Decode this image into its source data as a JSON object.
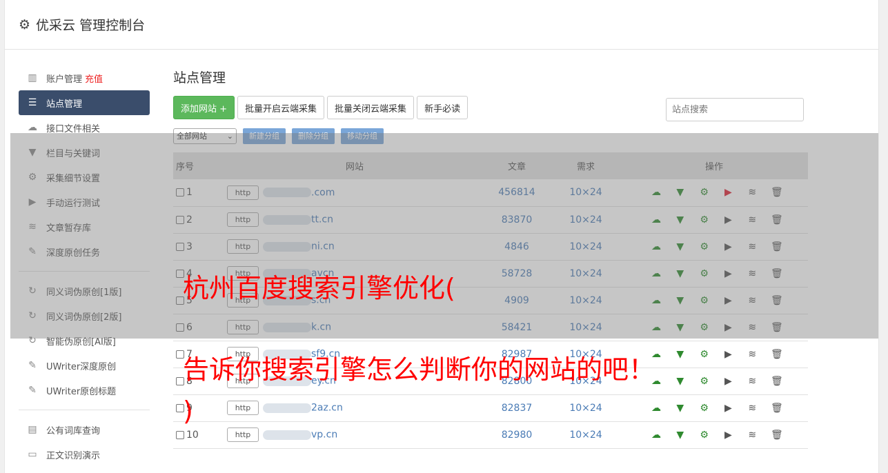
{
  "app": {
    "title": "优采云 管理控制台"
  },
  "sidebar": {
    "group1": [
      {
        "icon": "bar-chart-icon",
        "label": "账户管理",
        "badge": "充值"
      },
      {
        "icon": "server-icon",
        "label": "站点管理",
        "active": true
      },
      {
        "icon": "cloud-upload-icon",
        "label": "接口文件相关"
      },
      {
        "icon": "filter-icon",
        "label": "栏目与关键词"
      },
      {
        "icon": "gears-icon",
        "label": "采集细节设置"
      },
      {
        "icon": "play-icon",
        "label": "手动运行测试"
      },
      {
        "icon": "database-icon",
        "label": "文章暂存库"
      },
      {
        "icon": "edit-icon",
        "label": "深度原创任务"
      }
    ],
    "group2": [
      {
        "icon": "refresh-icon",
        "label": "同义词伪原创[1版]"
      },
      {
        "icon": "refresh-icon",
        "label": "同义词伪原创[2版]"
      },
      {
        "icon": "refresh-icon",
        "label": "智能伪原创[AI版]"
      },
      {
        "icon": "edit-icon",
        "label": "UWriter深度原创"
      },
      {
        "icon": "edit-icon",
        "label": "UWriter原创标题"
      }
    ],
    "group3": [
      {
        "icon": "book-icon",
        "label": "公有词库查询"
      },
      {
        "icon": "monitor-icon",
        "label": "正文识别演示"
      }
    ]
  },
  "main": {
    "title": "站点管理",
    "buttons": {
      "add": "添加网站 +",
      "batch_on": "批量开启云端采集",
      "batch_off": "批量关闭云端采集",
      "guide": "新手必读"
    },
    "search_placeholder": "站点搜索",
    "filter_select": "全部网站",
    "group_buttons": [
      "新建分组",
      "删除分组",
      "移动分组"
    ],
    "table": {
      "headers": [
        "序号",
        "网站",
        "文章",
        "需求",
        "操作"
      ],
      "rows": [
        {
          "no": "1",
          "proto": "http",
          "site": ".com",
          "articles": "456814",
          "demand": "10×24",
          "running": true
        },
        {
          "no": "2",
          "proto": "http",
          "site": "tt.cn",
          "articles": "83870",
          "demand": "10×24"
        },
        {
          "no": "3",
          "proto": "http",
          "site": "ni.cn",
          "articles": "4846",
          "demand": "10×24"
        },
        {
          "no": "4",
          "proto": "http",
          "site": "avcn",
          "articles": "58728",
          "demand": "10×24"
        },
        {
          "no": "5",
          "proto": "http",
          "site": "s.cn",
          "articles": "4909",
          "demand": "10×24"
        },
        {
          "no": "6",
          "proto": "http",
          "site": "k.cn",
          "articles": "58421",
          "demand": "10×24"
        },
        {
          "no": "7",
          "proto": "http",
          "site": "sf9.cn",
          "articles": "82987",
          "demand": "10×24"
        },
        {
          "no": "8",
          "proto": "http",
          "site": "ey.cn",
          "articles": "82800",
          "demand": "10×24"
        },
        {
          "no": "9",
          "proto": "http",
          "site": "2az.cn",
          "articles": "82837",
          "demand": "10×24"
        },
        {
          "no": "10",
          "proto": "http",
          "site": "vp.cn",
          "articles": "82980",
          "demand": "10×24"
        }
      ]
    }
  },
  "overlay": {
    "line1": "杭州百度搜索引擎优化(",
    "line2": "告诉你搜索引擎怎么判断你的网站的吧！",
    "line3": ")"
  },
  "colors": {
    "active_nav": "#3a4d6b",
    "add_button": "#5cb85c",
    "link": "#4a7bb5",
    "overlay_text": "#ff0000"
  }
}
